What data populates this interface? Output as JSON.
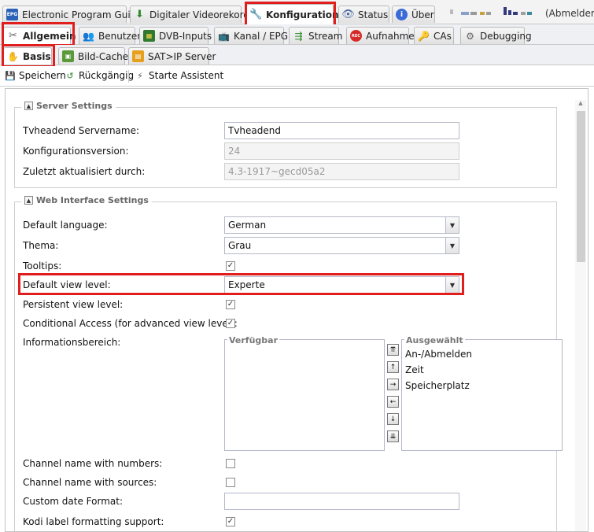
{
  "tabs_main": [
    {
      "label": "Electronic Program Guide",
      "icon": "epg-icon"
    },
    {
      "label": "Digitaler Videorekorder",
      "icon": "download-icon"
    },
    {
      "label": "Konfiguration",
      "icon": "wrench-icon",
      "active": true
    },
    {
      "label": "Status",
      "icon": "eye-icon"
    },
    {
      "label": "Über",
      "icon": "info-icon"
    }
  ],
  "logout": "(Abmelden)",
  "tabs_sub": [
    {
      "label": "Allgemein",
      "icon": "tools-icon",
      "active": true
    },
    {
      "label": "Benutzer",
      "icon": "users-icon"
    },
    {
      "label": "DVB-Inputs",
      "icon": "card-icon"
    },
    {
      "label": "Kanal / EPG",
      "icon": "tv-icon"
    },
    {
      "label": "Stream",
      "icon": "stream-icon"
    },
    {
      "label": "Aufnahme",
      "icon": "rec-icon"
    },
    {
      "label": "CAs",
      "icon": "key-icon"
    },
    {
      "label": "Debugging",
      "icon": "bug-icon"
    }
  ],
  "tabs_third": [
    {
      "label": "Basis",
      "icon": "hand-icon",
      "active": true
    },
    {
      "label": "Bild-Cache",
      "icon": "image-icon"
    },
    {
      "label": "SAT>IP Server",
      "icon": "satip-icon"
    }
  ],
  "toolbar": {
    "save": "Speichern",
    "undo": "Rückgängig",
    "wizard": "Starte Assistent"
  },
  "server": {
    "legend": "Server Settings",
    "name_label": "Tvheadend Servername:",
    "name_value": "Tvheadend",
    "version_label": "Konfigurationsversion:",
    "version_value": "24",
    "updated_label": "Zuletzt aktualisiert durch:",
    "updated_value": "4.3-1917~gecd05a2"
  },
  "web": {
    "legend": "Web Interface Settings",
    "language_label": "Default language:",
    "language_value": "German",
    "theme_label": "Thema:",
    "theme_value": "Grau",
    "tooltips_label": "Tooltips:",
    "viewlevel_label": "Default view level:",
    "viewlevel_value": "Experte",
    "persistent_label": "Persistent view level:",
    "ca_label": "Conditional Access (for advanced view level):",
    "info_label": "Informationsbereich:",
    "available_header": "Verfügbar",
    "selected_header": "Ausgewählt",
    "selected_items": [
      "An-/Abmelden",
      "Zeit",
      "Speicherplatz"
    ],
    "chnum_label": "Channel name with numbers:",
    "chsrc_label": "Channel name with sources:",
    "date_label": "Custom date Format:",
    "date_value": "",
    "kodi_label": "Kodi label formatting support:"
  },
  "checks": {
    "tooltips": true,
    "persistent": true,
    "ca": true,
    "chnum": false,
    "chsrc": false,
    "kodi": true
  }
}
